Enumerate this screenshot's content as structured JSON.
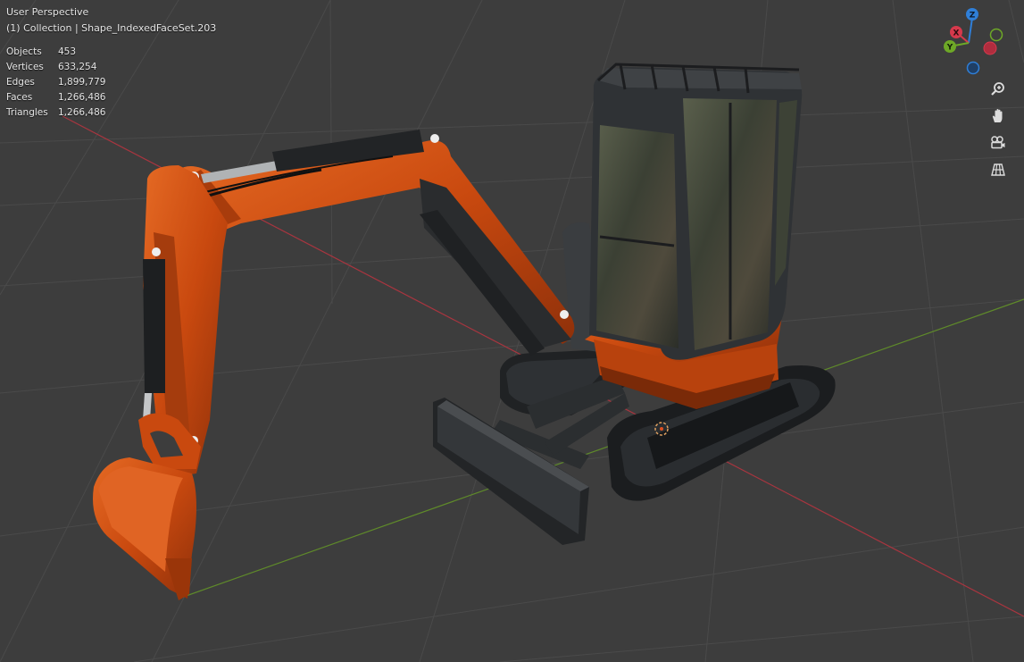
{
  "viewport": {
    "view_name": "User Perspective",
    "collection_info": "(1) Collection | Shape_IndexedFaceSet.203",
    "stats": [
      {
        "label": "Objects",
        "value": "453"
      },
      {
        "label": "Vertices",
        "value": "633,254"
      },
      {
        "label": "Edges",
        "value": "1,899,779"
      },
      {
        "label": "Faces",
        "value": "1,266,486"
      },
      {
        "label": "Triangles",
        "value": "1,266,486"
      }
    ]
  },
  "gizmo": {
    "axes": [
      {
        "label": "Z",
        "color": "#2f7fd8"
      },
      {
        "label": "X",
        "color": "#d6394c"
      },
      {
        "label": "Y",
        "color": "#6ea827"
      }
    ]
  },
  "nav_tools": [
    {
      "name": "zoom-icon"
    },
    {
      "name": "pan-hand-icon"
    },
    {
      "name": "camera-view-icon"
    },
    {
      "name": "ortho-grid-icon"
    }
  ],
  "colors": {
    "background": "#3d3d3d",
    "grid": "#474747",
    "x_axis": "#a8353f",
    "y_axis": "#5f8a2a",
    "excavator_orange": "#c84a10",
    "dark_metal": "#2a2c2e"
  }
}
